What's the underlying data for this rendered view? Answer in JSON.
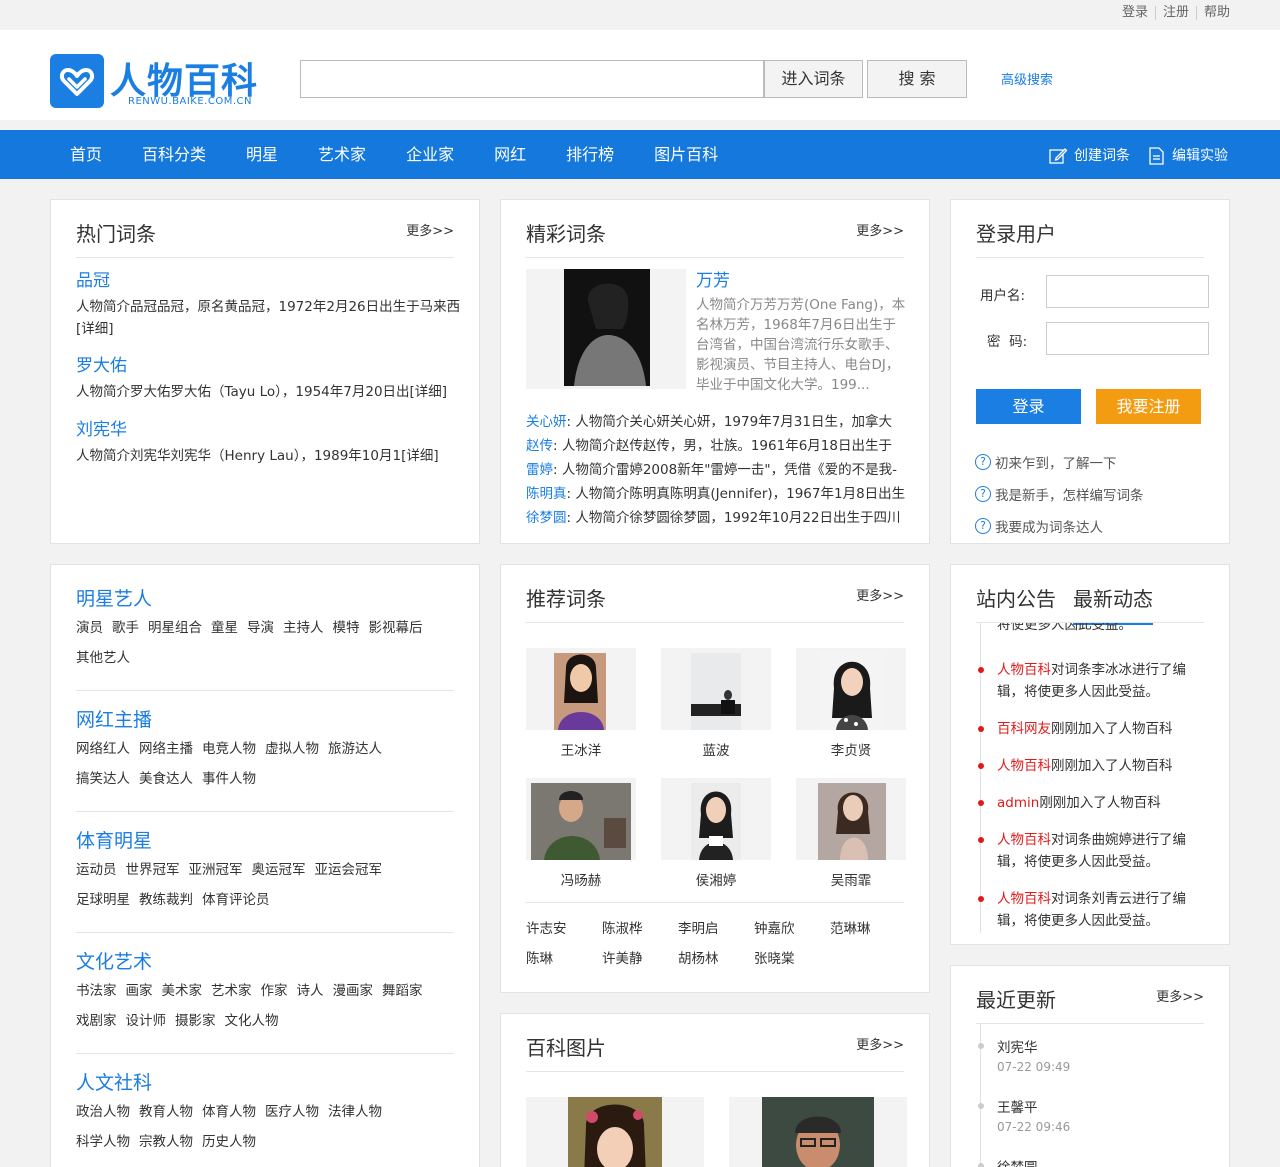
{
  "top_links": [
    "登录",
    "注册",
    "帮助"
  ],
  "logo": {
    "title": "人物百科",
    "subtitle": "RENWU.BAIKE.COM.CN"
  },
  "search": {
    "enter_label": "进入词条",
    "search_label": "搜 索",
    "advanced_label": "高级搜索"
  },
  "nav": {
    "items": [
      "首页",
      "百科分类",
      "明星",
      "艺术家",
      "企业家",
      "网红",
      "排行榜",
      "图片百科"
    ],
    "create_label": "创建词条",
    "edit_label": "编辑实验"
  },
  "hot": {
    "title": "热门词条",
    "more": "更多>>",
    "entries": [
      {
        "name": "品冠",
        "desc": "人物简介品冠品冠，原名黄品冠，1972年2月26日出生于马来西[详细]"
      },
      {
        "name": "罗大佑",
        "desc": "人物简介罗大佑罗大佑（Tayu Lo），1954年7月20日出[详细]"
      },
      {
        "name": "刘宪华",
        "desc": "人物简介刘宪华刘宪华（Henry Lau），1989年10月1[详细]"
      }
    ]
  },
  "featured": {
    "title": "精彩词条",
    "more": "更多>>",
    "main": {
      "name": "万芳",
      "desc": "人物简介万芳万芳(One Fang)，本名林万芳，1968年7月6日出生于台湾省，中国台湾流行乐女歌手、影视演员、节目主持人、电台DJ，毕业于中国文化大学。199..."
    },
    "list": [
      {
        "name": "关心妍",
        "desc": ": 人物简介关心妍关心妍，1979年7月31日生，加拿大"
      },
      {
        "name": "赵传",
        "desc": ": 人物简介赵传赵传，男，壮族。1961年6月18日出生于"
      },
      {
        "name": "雷婷",
        "desc": ": 人物简介雷婷2008新年\"雷婷一击\"，凭借《爱的不是我-"
      },
      {
        "name": "陈明真",
        "desc": ": 人物简介陈明真陈明真(Jennifer)，1967年1月8日出生"
      },
      {
        "name": "徐梦圆",
        "desc": ": 人物简介徐梦圆徐梦圆，1992年10月22日出生于四川"
      }
    ]
  },
  "login": {
    "title": "登录用户",
    "username_label": "用户名:",
    "password_label": "密  码:",
    "login_button": "登录",
    "register_button": "我要注册",
    "help": [
      "初来乍到，了解一下",
      "我是新手，怎样编写词条",
      "我要成为词条达人"
    ]
  },
  "categories": [
    {
      "name": "明星艺人",
      "tags": [
        [
          "演员",
          "歌手",
          "明星组合",
          "童星",
          "导演",
          "主持人",
          "模特",
          "影视幕后"
        ],
        [
          "其他艺人"
        ]
      ]
    },
    {
      "name": "网红主播",
      "tags": [
        [
          "网络红人",
          "网络主播",
          "电竞人物",
          "虚拟人物",
          "旅游达人"
        ],
        [
          "搞笑达人",
          "美食达人",
          "事件人物"
        ]
      ]
    },
    {
      "name": "体育明星",
      "tags": [
        [
          "运动员",
          "世界冠军",
          "亚洲冠军",
          "奥运冠军",
          "亚运会冠军"
        ],
        [
          "足球明星",
          "教练裁判",
          "体育评论员"
        ]
      ]
    },
    {
      "name": "文化艺术",
      "tags": [
        [
          "书法家",
          "画家",
          "美术家",
          "艺术家",
          "作家",
          "诗人",
          "漫画家",
          "舞蹈家"
        ],
        [
          "戏剧家",
          "设计师",
          "摄影家",
          "文化人物"
        ]
      ]
    },
    {
      "name": "人文社科",
      "tags": [
        [
          "政治人物",
          "教育人物",
          "体育人物",
          "医疗人物",
          "法律人物"
        ],
        [
          "科学人物",
          "宗教人物",
          "历史人物"
        ]
      ]
    }
  ],
  "recommended": {
    "title": "推荐词条",
    "more": "更多>>",
    "pictures": [
      "王冰洋",
      "蓝波",
      "李贞贤",
      "冯旸赫",
      "侯湘婷",
      "吴雨霏"
    ],
    "names_row1": [
      "许志安",
      "陈淑桦",
      "李明启",
      "钟嘉欣",
      "范琳琳"
    ],
    "names_row2": [
      "陈琳",
      "许美静",
      "胡杨林",
      "张晓棠"
    ]
  },
  "gallery": {
    "title": "百科图片",
    "more": "更多>>"
  },
  "notice": {
    "tab1": "站内公告",
    "tab2": "最新动态",
    "partial": "将使更多人因此受益。",
    "items": [
      {
        "who": "人物百科",
        "text": "对词条李冰冰进行了编辑，将使更多人因此受益。"
      },
      {
        "who": "百科网友",
        "text": "刚刚加入了人物百科"
      },
      {
        "who": "人物百科",
        "text": "刚刚加入了人物百科"
      },
      {
        "who": "admin",
        "text": "刚刚加入了人物百科"
      },
      {
        "who": "人物百科",
        "text": "对词条曲婉婷进行了编辑，将使更多人因此受益。"
      },
      {
        "who": "人物百科",
        "text": "对词条刘青云进行了编辑，将使更多人因此受益。"
      }
    ]
  },
  "recent": {
    "title": "最近更新",
    "more": "更多>>",
    "items": [
      {
        "name": "刘宪华",
        "time": "07-22 09:49"
      },
      {
        "name": "王馨平",
        "time": "07-22 09:46"
      },
      {
        "name": "徐梦圆",
        "time": ""
      }
    ]
  }
}
